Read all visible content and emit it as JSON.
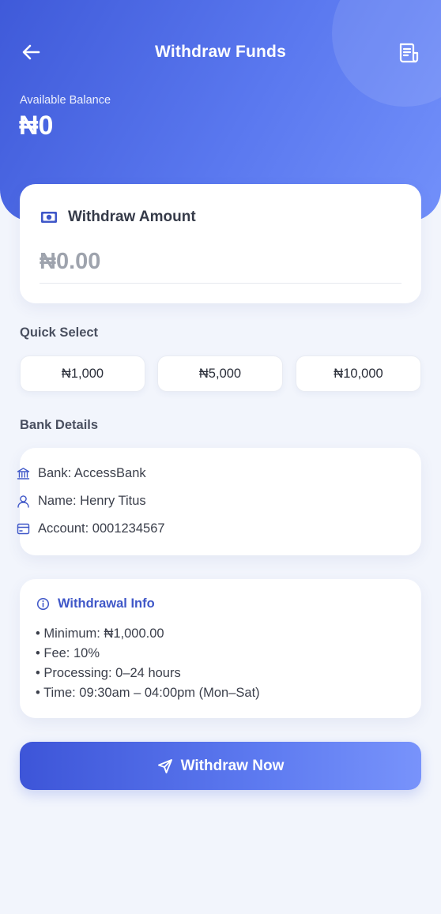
{
  "header": {
    "title": "Withdraw Funds",
    "balance_label": "Available Balance",
    "balance_value": "₦0"
  },
  "amount_card": {
    "label": "Withdraw Amount",
    "placeholder": "₦0.00"
  },
  "quick_select": {
    "title": "Quick Select",
    "options": [
      "₦1,000",
      "₦5,000",
      "₦10,000"
    ]
  },
  "bank_details": {
    "title": "Bank Details",
    "bank": "Bank: AccessBank",
    "name": "Name: Henry Titus",
    "account": "Account: 0001234567"
  },
  "withdrawal_info": {
    "title": "Withdrawal Info",
    "items": [
      "• Minimum: ₦1,000.00",
      "• Fee: 10%",
      "• Processing: 0–24 hours",
      "• Time: 09:30am – 04:00pm (Mon–Sat)"
    ]
  },
  "action": {
    "label": "Withdraw Now"
  },
  "icons": {
    "back": "arrow-left-icon",
    "history": "receipt-icon",
    "amount": "cash-icon",
    "bank": "bank-icon",
    "name": "user-icon",
    "account": "card-icon",
    "info": "info-icon",
    "send": "send-icon"
  },
  "colors": {
    "primary": "#3f5ad9",
    "primary_light": "#7290fa",
    "background": "#f2f5fc",
    "accent_text": "#3f57c8"
  }
}
